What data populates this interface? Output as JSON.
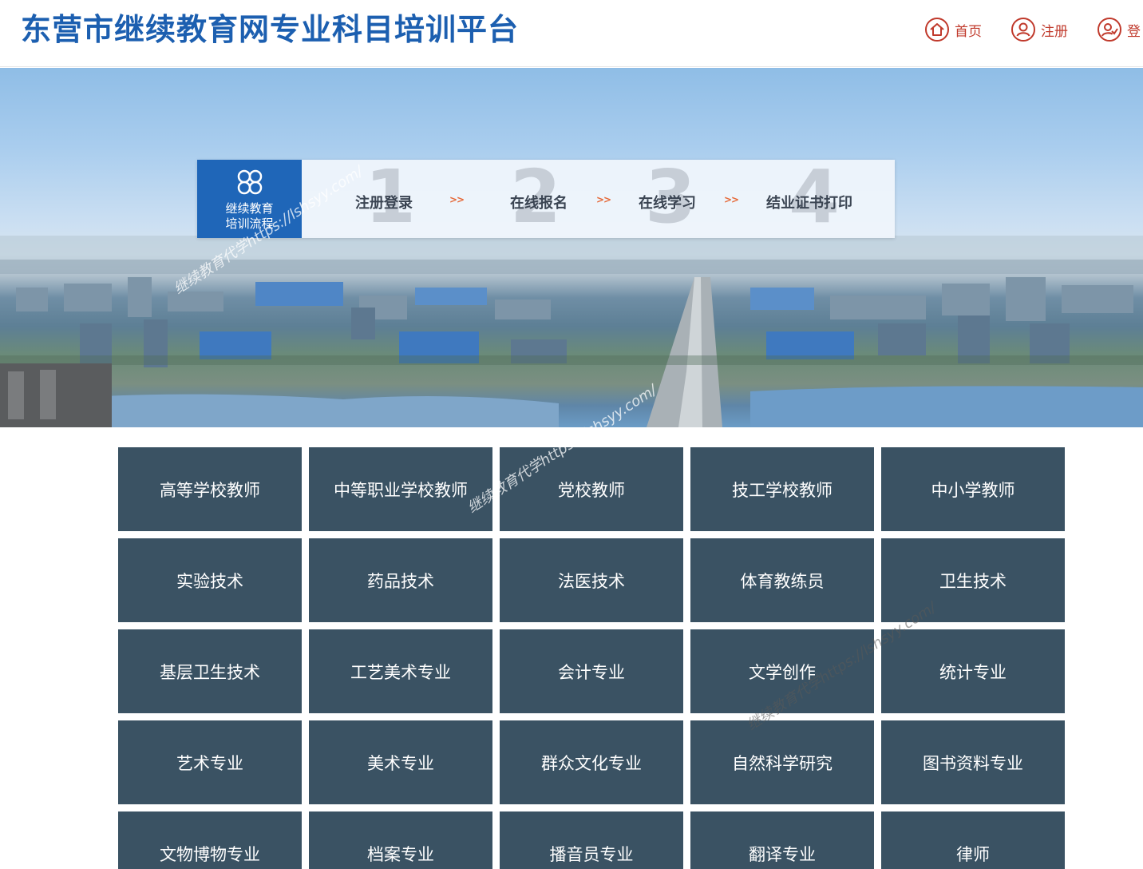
{
  "header": {
    "title": "东营市继续教育网专业科目培训平台",
    "nav": [
      {
        "label": "首页",
        "icon": "home-icon"
      },
      {
        "label": "注册",
        "icon": "user-icon"
      },
      {
        "label": "登",
        "icon": "user-check-icon"
      }
    ]
  },
  "banner": {
    "badge_line1": "继续教育",
    "badge_line2": "培训流程",
    "steps": [
      {
        "num": "1",
        "label": "注册登录"
      },
      {
        "num": "2",
        "label": "在线报名"
      },
      {
        "num": "3",
        "label": "在线学习"
      },
      {
        "num": "4",
        "label": "结业证书打印"
      }
    ],
    "arrow": ">>"
  },
  "categories": [
    "高等学校教师",
    "中等职业学校教师",
    "党校教师",
    "技工学校教师",
    "中小学教师",
    "实验技术",
    "药品技术",
    "法医技术",
    "体育教练员",
    "卫生技术",
    "基层卫生技术",
    "工艺美术专业",
    "会计专业",
    "文学创作",
    "统计专业",
    "艺术专业",
    "美术专业",
    "群众文化专业",
    "自然科学研究",
    "图书资料专业",
    "文物博物专业",
    "档案专业",
    "播音员专业",
    "翻译专业",
    "律师"
  ],
  "watermark": "继续教育代学https://lshsyy.com/",
  "colors": {
    "title": "#1c5fb0",
    "nav": "#c0392b",
    "badge": "#1f66b8",
    "cell": "#3a5263"
  }
}
